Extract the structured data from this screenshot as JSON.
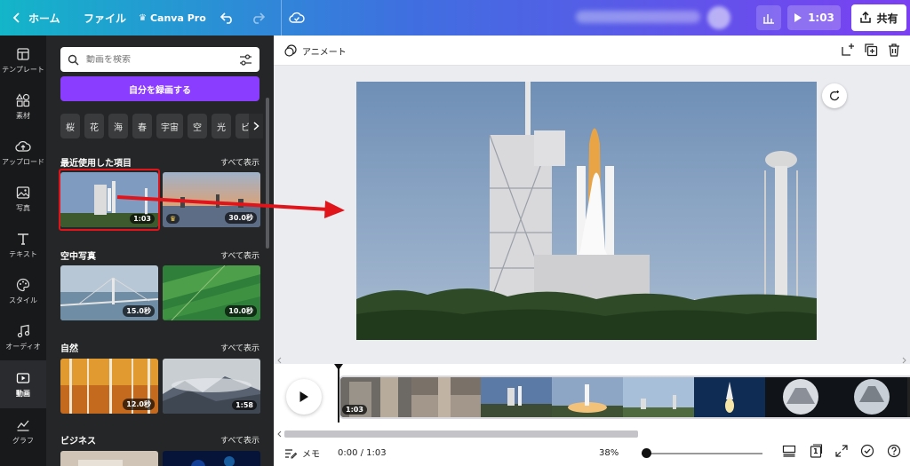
{
  "topbar": {
    "home": "ホーム",
    "file": "ファイル",
    "canva_pro": "Canva Pro",
    "play_time": "1:03",
    "share": "共有"
  },
  "rail": {
    "items": [
      {
        "label": "テンプレート",
        "icon": "template-icon"
      },
      {
        "label": "素材",
        "icon": "elements-icon"
      },
      {
        "label": "アップロード",
        "icon": "upload-icon"
      },
      {
        "label": "写真",
        "icon": "photo-icon"
      },
      {
        "label": "テキスト",
        "icon": "text-icon"
      },
      {
        "label": "スタイル",
        "icon": "style-icon"
      },
      {
        "label": "オーディオ",
        "icon": "audio-icon"
      },
      {
        "label": "動画",
        "icon": "video-icon"
      },
      {
        "label": "グラフ",
        "icon": "chart-icon"
      }
    ]
  },
  "panel": {
    "search_placeholder": "動画を検索",
    "record_button": "自分を録画する",
    "chips": [
      "桜",
      "花",
      "海",
      "春",
      "宇宙",
      "空",
      "光",
      "ビ"
    ],
    "sections": [
      {
        "title": "最近使用した項目",
        "see_all": "すべて表示",
        "items": [
          {
            "duration": "1:03"
          },
          {
            "duration": "30.0秒"
          }
        ]
      },
      {
        "title": "空中写真",
        "see_all": "すべて表示",
        "items": [
          {
            "duration": "15.0秒"
          },
          {
            "duration": "10.0秒"
          }
        ]
      },
      {
        "title": "自然",
        "see_all": "すべて表示",
        "items": [
          {
            "duration": "12.0秒"
          },
          {
            "duration": "1:58"
          }
        ]
      },
      {
        "title": "ビジネス",
        "see_all": "すべて表示"
      }
    ]
  },
  "editor": {
    "animate": "アニメート"
  },
  "timeline": {
    "clip_duration": "1:03"
  },
  "bottombar": {
    "memo": "メモ",
    "timecode": "0:00 / 1:03",
    "zoom": "38%",
    "page_number": "1"
  },
  "colors": {
    "accent": "#8b3dff",
    "highlight": "#e0141b"
  }
}
